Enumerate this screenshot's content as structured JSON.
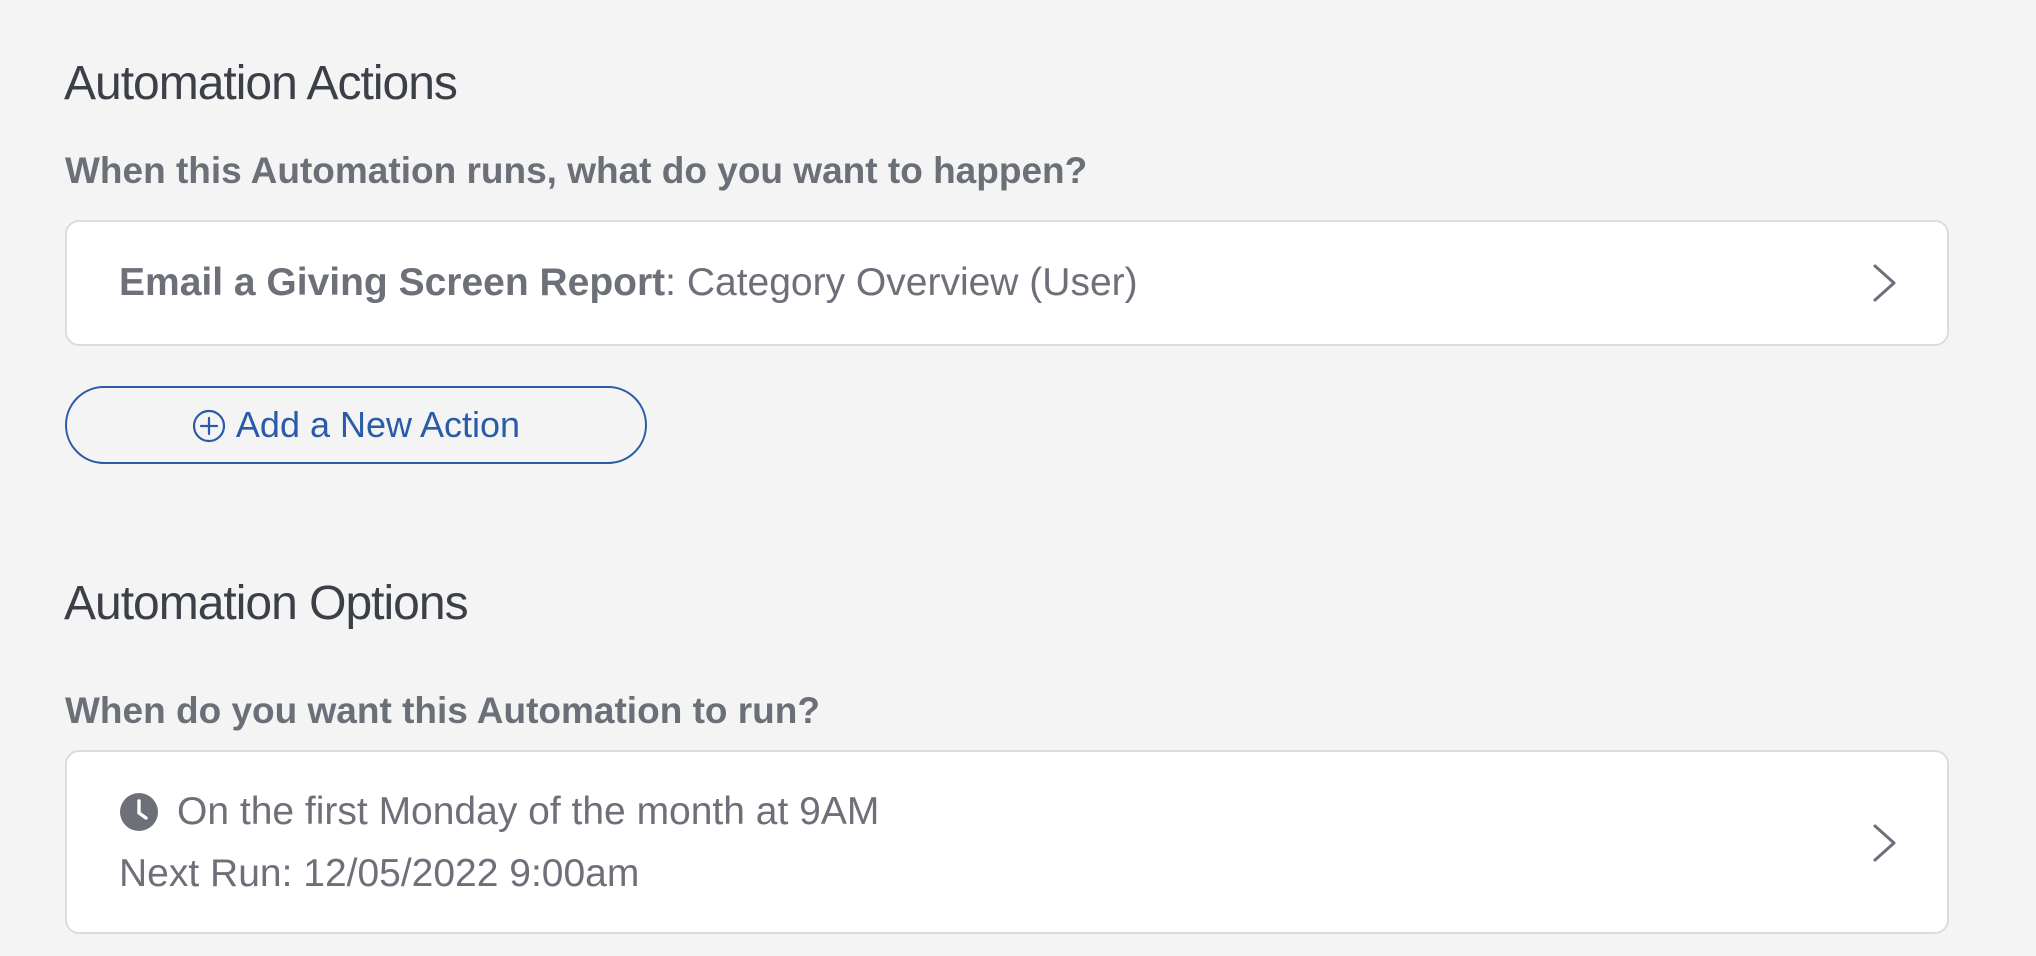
{
  "actions_section": {
    "heading": "Automation Actions",
    "question": "When this Automation runs, what do you want to happen?",
    "action_card": {
      "action_type": "Email a Giving Screen Report",
      "separator": ": ",
      "action_detail": "Category Overview (User)"
    },
    "add_button_label": "Add a New Action"
  },
  "options_section": {
    "heading": "Automation Options",
    "question": "When do you want this Automation to run?",
    "schedule_card": {
      "schedule": "On the first Monday of the month at 9AM",
      "next_run_label": "Next Run:",
      "next_run_value": "12/05/2022 9:00am"
    }
  },
  "icons": {
    "add": "plus-circle-icon",
    "schedule": "clock-icon",
    "navigate": "chevron-right-icon"
  },
  "colors": {
    "background": "#f4f4f4",
    "heading_text": "#3b3f47",
    "body_text": "#6d7079",
    "accent": "#2a5ba8",
    "card_border": "#dcdcdc"
  }
}
